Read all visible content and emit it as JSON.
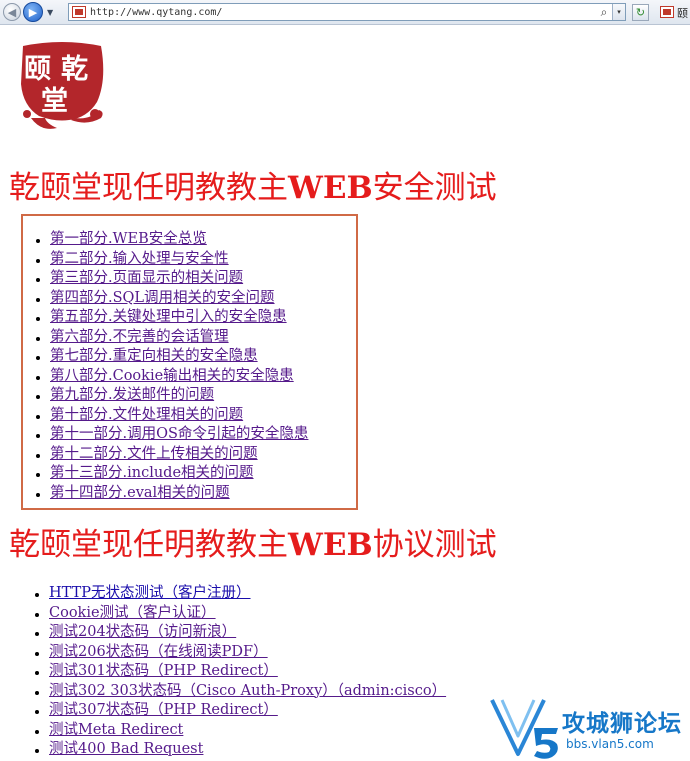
{
  "browser": {
    "address_url": "http://www.qytang.com/",
    "search_glyph": "⌕",
    "dropdown_glyph": "▾",
    "refresh_glyph": "↻",
    "tab_caption": "颐",
    "back_glyph": "◀",
    "forward_glyph": "▶",
    "history_glyph": "▼"
  },
  "logo": {
    "text": "颐乾堂",
    "color": "#b3262b"
  },
  "section1": {
    "title_prefix": "乾颐堂现任明教教主",
    "title_bold": "WEB",
    "title_suffix": "安全测试",
    "links": [
      "第一部分.WEB安全总览",
      "第二部分.输入处理与安全性",
      "第三部分.页面显示的相关问题",
      "第四部分.SQL调用相关的安全问题",
      "第五部分.关键处理中引入的安全隐患",
      "第六部分.不完善的会话管理",
      "第七部分.重定向相关的安全隐患",
      "第八部分.Cookie输出相关的安全隐患",
      "第九部分.发送邮件的问题",
      "第十部分.文件处理相关的问题",
      "第十一部分.调用OS命令引起的安全隐患",
      "第十二部分.文件上传相关的问题",
      "第十三部分.include相关的问题",
      "第十四部分.eval相关的问题"
    ]
  },
  "section2": {
    "title_prefix": "乾颐堂现任明教教主",
    "title_bold": "WEB",
    "title_suffix": "协议测试",
    "links": [
      "HTTP无状态测试（客户注册）",
      "Cookie测试（客户认证）",
      "测试204状态码（访问新浪）",
      "测试206状态码（在线阅读PDF）",
      "测试301状态码（PHP Redirect）",
      "测试302 303状态码（Cisco Auth-Proxy）（admin:cisco）",
      "测试307状态码（PHP Redirect）",
      "测试Meta Redirect",
      "测试400 Bad Request"
    ]
  },
  "watermark": {
    "logo_letter": "V5",
    "main": "攻城狮论坛",
    "sub": "bbs.vlan5.com",
    "color": "#1677c8"
  },
  "colors": {
    "title_red": "#e51c1c",
    "box_border": "#d06a46",
    "visited_link": "#551a8b",
    "link": "#1a0dab"
  }
}
